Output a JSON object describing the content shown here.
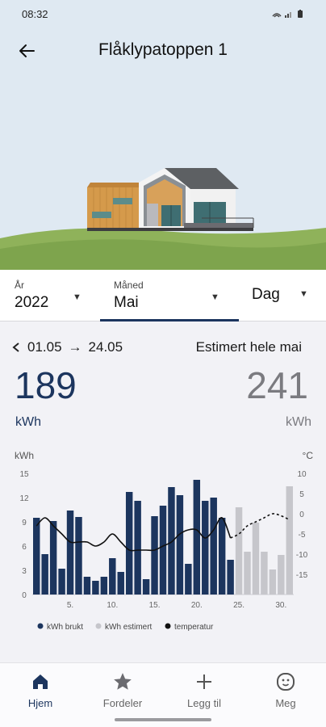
{
  "status": {
    "time": "08:32"
  },
  "header": {
    "title": "Flåklypatoppen 1"
  },
  "selectors": {
    "year": {
      "label": "År",
      "value": "2022"
    },
    "month": {
      "label": "Måned",
      "value": "Mai"
    },
    "day": {
      "value": "Dag"
    }
  },
  "summary": {
    "period_start": "01.05",
    "arrow": "→",
    "period_end": "24.05",
    "estimate_title": "Estimert hele mai",
    "used_value": "189",
    "used_unit": "kWh",
    "estimated_value": "241",
    "estimated_unit": "kWh"
  },
  "colors": {
    "accent": "#1c355e",
    "estimate": "#c6c6cb",
    "temperature": "#111111"
  },
  "chart_data": {
    "type": "bar",
    "ylabel_left": "kWh",
    "ylabel_right": "°C",
    "ylim_left": [
      0,
      15
    ],
    "ylim_right": [
      -20,
      10
    ],
    "yticks_left": [
      "0",
      "3",
      "6",
      "9",
      "12",
      "15"
    ],
    "yticks_right": [
      "-15",
      "-10",
      "-5",
      "0",
      "5",
      "10"
    ],
    "x_tick_labels": [
      "5.",
      "10.",
      "15.",
      "20.",
      "25.",
      "30."
    ],
    "x_tick_days": [
      5,
      10,
      15,
      20,
      25,
      30
    ],
    "days": [
      1,
      2,
      3,
      4,
      5,
      6,
      7,
      8,
      9,
      10,
      11,
      12,
      13,
      14,
      15,
      16,
      17,
      18,
      19,
      20,
      21,
      22,
      23,
      24,
      25,
      26,
      27,
      28,
      29,
      30,
      31
    ],
    "series": [
      {
        "name": "kWh brukt",
        "kind": "bar",
        "days": [
          1,
          2,
          3,
          4,
          5,
          6,
          7,
          8,
          9,
          10,
          11,
          12,
          13,
          14,
          15,
          16,
          17,
          18,
          19,
          20,
          21,
          22,
          23,
          24
        ],
        "values": [
          9.5,
          5.0,
          9.1,
          3.2,
          10.4,
          9.6,
          2.2,
          1.7,
          2.2,
          4.5,
          2.8,
          12.7,
          11.6,
          1.9,
          9.7,
          11.0,
          13.3,
          12.3,
          3.8,
          14.2,
          11.6,
          12.0,
          9.5,
          4.3
        ]
      },
      {
        "name": "kWh estimert",
        "kind": "bar",
        "days": [
          25,
          26,
          27,
          28,
          29,
          30,
          31
        ],
        "values": [
          10.8,
          5.3,
          8.9,
          5.3,
          3.1,
          4.9,
          13.4
        ]
      },
      {
        "name": "temperatur",
        "kind": "line",
        "days": [
          1,
          2,
          3,
          4,
          5,
          6,
          7,
          8,
          9,
          10,
          11,
          12,
          13,
          14,
          15,
          16,
          17,
          18,
          19,
          20,
          21,
          22,
          23,
          24,
          25,
          26,
          27,
          28,
          29,
          30,
          31
        ],
        "values": [
          -3,
          -1,
          -3,
          -5,
          -7,
          -7,
          -7,
          -8,
          -7,
          -5,
          -7,
          -9,
          -9,
          -9,
          -9,
          -8,
          -7,
          -5,
          -4,
          -4,
          -6,
          -4,
          -1,
          -6,
          -5,
          -3,
          -2,
          -1,
          0,
          -0.5,
          -1.5
        ]
      }
    ],
    "legend": [
      "kWh brukt",
      "kWh estimert",
      "temperatur"
    ],
    "legend_position": "bottom"
  },
  "nav": {
    "items": [
      {
        "label": "Hjem",
        "icon": "home-icon"
      },
      {
        "label": "Fordeler",
        "icon": "star-icon"
      },
      {
        "label": "Legg til",
        "icon": "plus-icon"
      },
      {
        "label": "Meg",
        "icon": "face-icon"
      }
    ]
  }
}
